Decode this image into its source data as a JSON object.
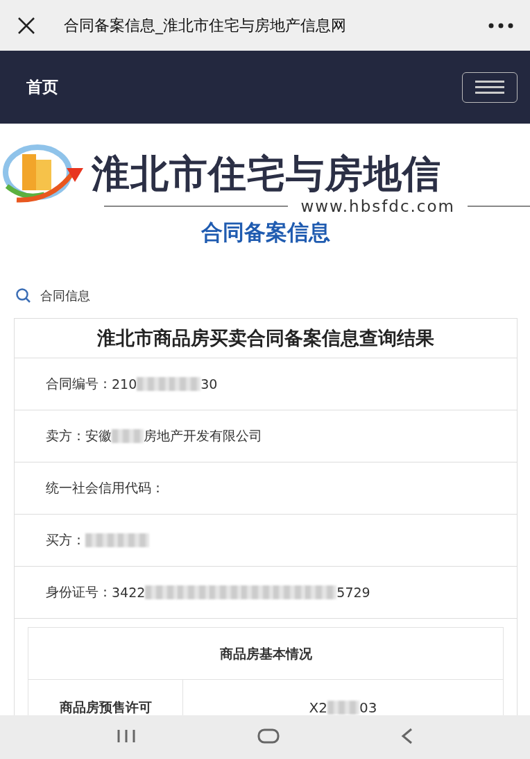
{
  "browser_bar": {
    "title": "合同备案信息_淮北市住宅与房地产信息网"
  },
  "navbar": {
    "home": "首页"
  },
  "banner": {
    "site_name": "淮北市住宅与房地信",
    "url": "www.hbsfdc.com",
    "page_heading": "合同备案信息"
  },
  "breadcrumb": {
    "label": "合同信息"
  },
  "result_card": {
    "title": "淮北市商品房买卖合同备案信息查询结果",
    "rows": [
      {
        "label": "合同编号：",
        "segments": [
          {
            "kind": "text",
            "text": "210"
          },
          {
            "kind": "redacted"
          },
          {
            "kind": "redacted"
          },
          {
            "kind": "text",
            "text": "30"
          }
        ]
      },
      {
        "label": "卖方：",
        "segments": [
          {
            "kind": "text",
            "text": "安徽"
          },
          {
            "kind": "redacted"
          },
          {
            "kind": "text",
            "text": "房地产开发有限公司"
          }
        ]
      },
      {
        "label": "统一社会信用代码：",
        "segments": []
      },
      {
        "label": "买方：",
        "segments": [
          {
            "kind": "redacted"
          },
          {
            "kind": "redacted"
          }
        ]
      },
      {
        "label": "身份证号：",
        "segments": [
          {
            "kind": "text",
            "text": "3422"
          },
          {
            "kind": "redacted"
          },
          {
            "kind": "redacted"
          },
          {
            "kind": "redacted"
          },
          {
            "kind": "redacted"
          },
          {
            "kind": "redacted"
          },
          {
            "kind": "redacted"
          },
          {
            "kind": "text",
            "text": "5729"
          }
        ]
      }
    ],
    "basic_info": {
      "title": "商品房基本情况",
      "rows": [
        {
          "label": "商品房预售许可",
          "segments": [
            {
              "kind": "text",
              "text": "X2"
            },
            {
              "kind": "redacted"
            },
            {
              "kind": "text",
              "text": "03"
            }
          ]
        }
      ]
    }
  }
}
